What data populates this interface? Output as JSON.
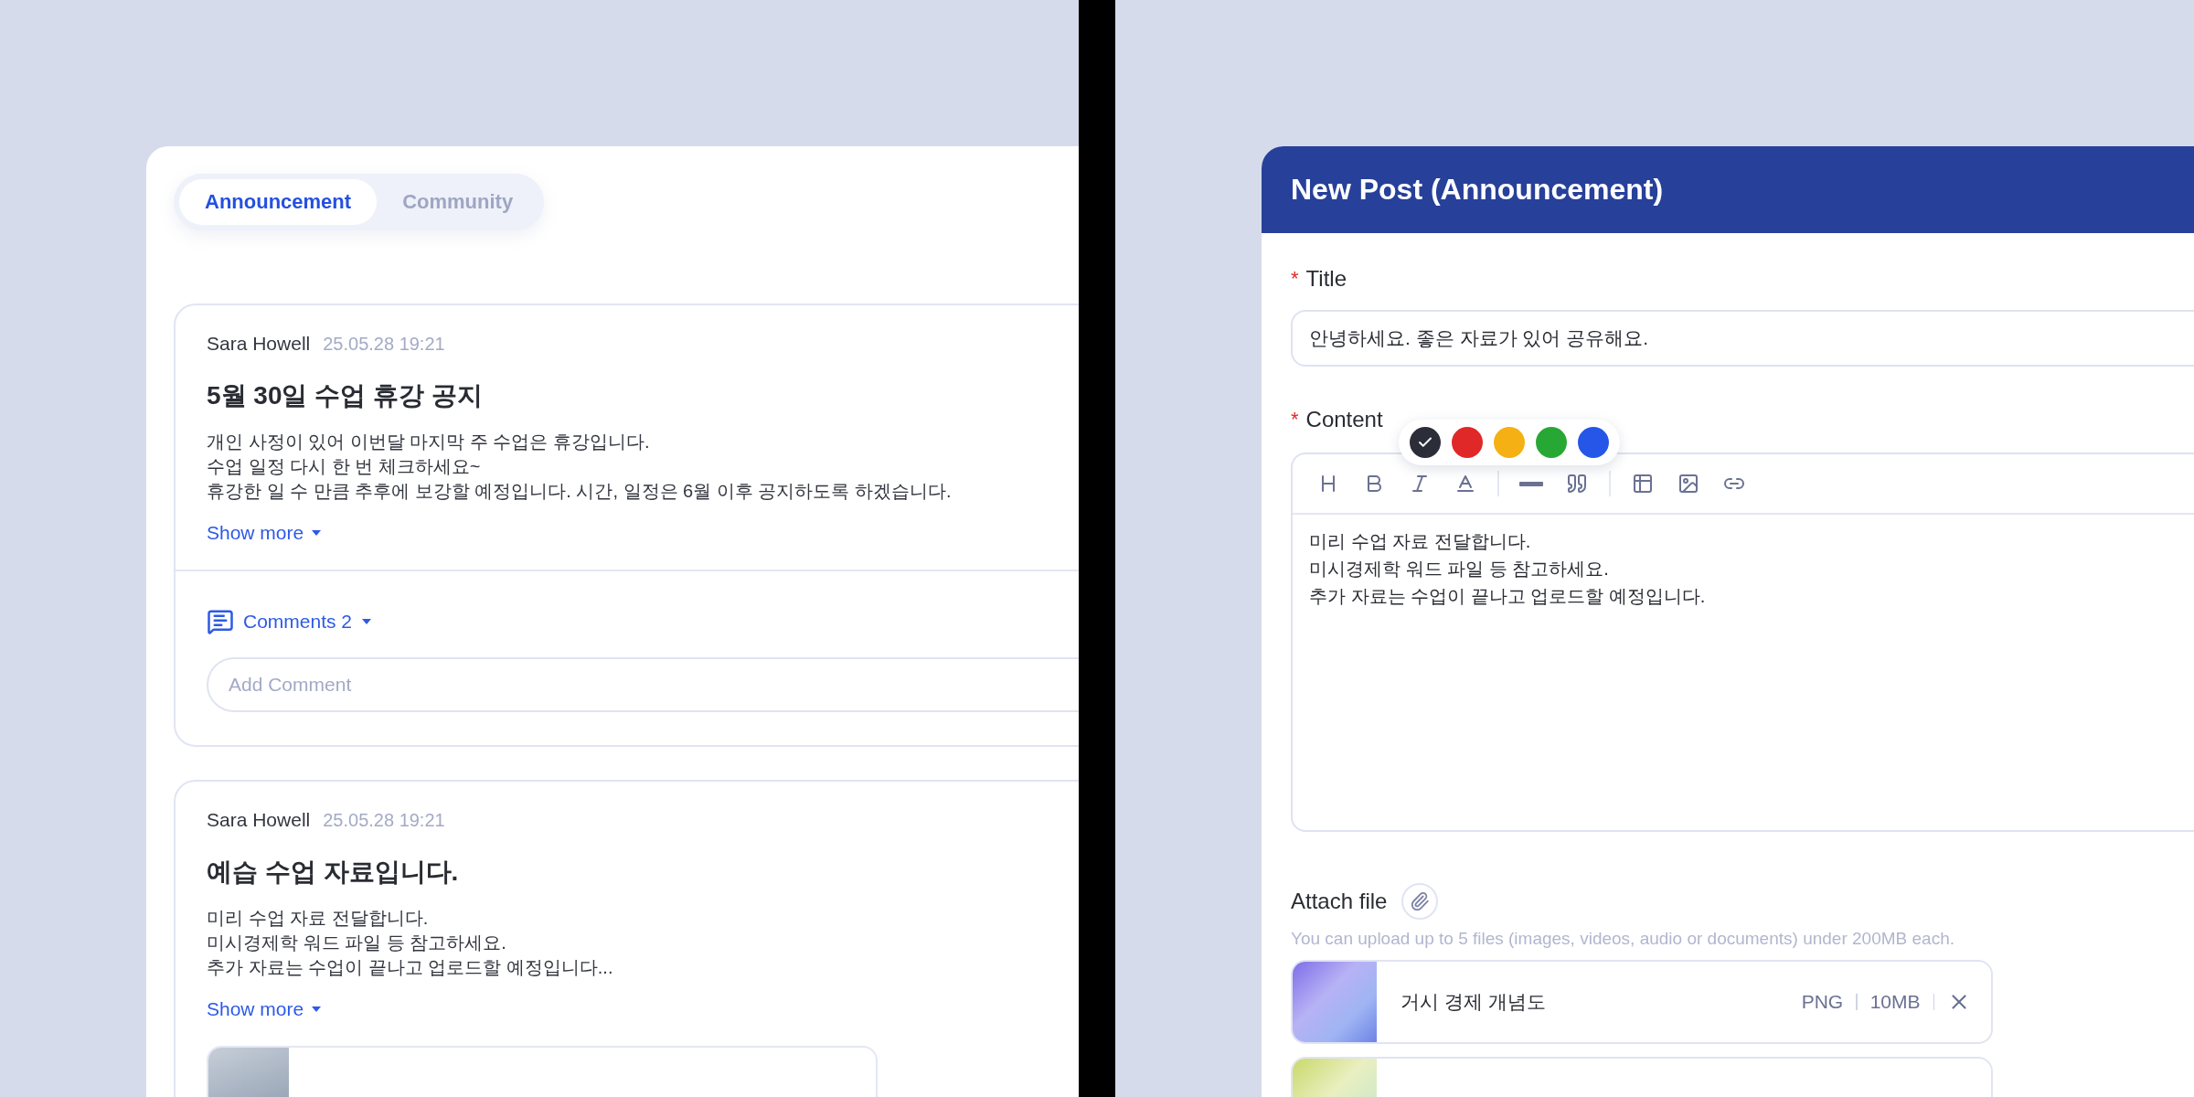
{
  "tabs": [
    {
      "label": "Announcement",
      "selected": true
    },
    {
      "label": "Community",
      "selected": false
    }
  ],
  "posts": [
    {
      "author": "Sara Howell",
      "time": "25.05.28 19:21",
      "title": "5월 30일 수업 휴강 공지",
      "body": "개인 사정이 있어 이번달 마지막 주 수업은 휴강입니다.\n수업 일정 다시 한 번 체크하세요~\n휴강한 일 수 만큼 추후에 보강할 예정입니다. 시간, 일정은 6월 이후 공지하도록 하겠습니다.",
      "show_more": "Show more",
      "comments": {
        "label": "Comments 2",
        "placeholder": "Add Comment"
      }
    },
    {
      "author": "Sara Howell",
      "time": "25.05.28 19:21",
      "title": "예습 수업 자료입니다.",
      "body": "미리 수업 자료 전달합니다.\n미시경제학 워드 파일 등 참고하세요.\n추가 자료는 수업이 끝나고 업로드할 예정입니다...",
      "show_more": "Show more",
      "attachments": [
        {
          "kind": "image"
        }
      ]
    }
  ],
  "editor": {
    "header": "New Post (Announcement)",
    "title_field": {
      "label": "Title",
      "required_mark": "*",
      "value": "안녕하세요. 좋은 자료가 있어 공유해요."
    },
    "content_field": {
      "label": "Content",
      "required_mark": "*",
      "text": "미리 수업 자료 전달합니다.\n미시경제학 워드 파일 등 참고하세요.\n추가 자료는 수업이 끝나고 업로드할 예정입니다.",
      "colors": [
        {
          "color": "#2b2d38",
          "selected": true
        },
        {
          "color": "#e02828",
          "selected": false
        },
        {
          "color": "#f5b014",
          "selected": false
        },
        {
          "color": "#27a834",
          "selected": false
        },
        {
          "color": "#2556e8",
          "selected": false
        }
      ]
    },
    "attach": {
      "label": "Attach file",
      "hint": "You can upload up to 5 files (images, videos, audio or documents) under 200MB each.",
      "files": [
        {
          "kind": "image",
          "name": "거시 경제 개념도",
          "type": "PNG",
          "size": "10MB"
        },
        {
          "kind": "image"
        }
      ]
    }
  }
}
